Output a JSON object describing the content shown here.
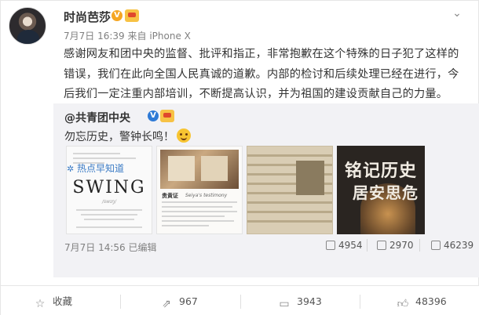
{
  "post": {
    "username": "时尚芭莎",
    "verified_badge": "V",
    "time": "7月7日 16:39",
    "source_prefix": "来自",
    "source": "iPhone X",
    "text": "感谢网友和团中央的监督、批评和指正，非常抱歉在这个特殊的日子犯了这样的错误，我们在此向全国人民真诚的道歉。内部的检讨和后续处理已经在进行，今后我们一定注重内部培训，不断提高认识，并为祖国的建设贡献自己的力量。"
  },
  "repost": {
    "username": "@共青团中央",
    "verified_badge": "V",
    "text": "勿忘历史，警钟长鸣！",
    "emoji": "smile-emoji",
    "images": [
      {
        "icon": "swing-article-image",
        "headline": "SWING",
        "subline": "/swɪŋ/"
      },
      {
        "icon": "historical-photo-image",
        "caption": "贵黄证",
        "caption_sub": "Seiya's testimony"
      },
      {
        "icon": "old-newspaper-image"
      },
      {
        "icon": "memorial-calligraphy-image",
        "line1": "铭记历史",
        "line2": "居安思危"
      }
    ],
    "time": "7月7日 14:56",
    "edited": "已编辑",
    "stats": {
      "forwards": "4954",
      "comments": "2970",
      "likes": "46239"
    }
  },
  "hot_link": "热点早知道",
  "actions": {
    "favorite": "收藏",
    "forward": "967",
    "comment": "3943",
    "like": "48396"
  },
  "colors": {
    "link": "#3b7bc5",
    "repost_bg": "#f2f2f5",
    "text": "#333333",
    "meta": "#808080"
  }
}
